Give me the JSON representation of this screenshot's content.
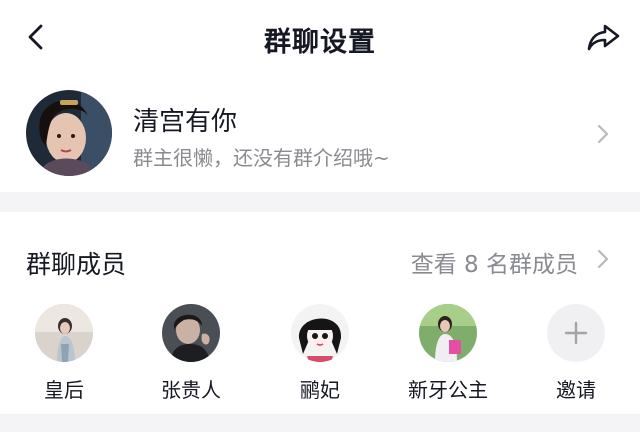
{
  "header": {
    "title": "群聊设置",
    "back_icon": "chevron-left-icon",
    "share_icon": "share-arrow-icon"
  },
  "group": {
    "name": "清宫有你",
    "description": "群主很懒，还没有群介绍哦~"
  },
  "members": {
    "title": "群聊成员",
    "view_all_label": "查看 8 名群成员",
    "list": [
      {
        "name": "皇后"
      },
      {
        "name": "张贵人"
      },
      {
        "name": "鹂妃"
      },
      {
        "name": "新牙公主"
      }
    ],
    "invite_label": "邀请"
  }
}
